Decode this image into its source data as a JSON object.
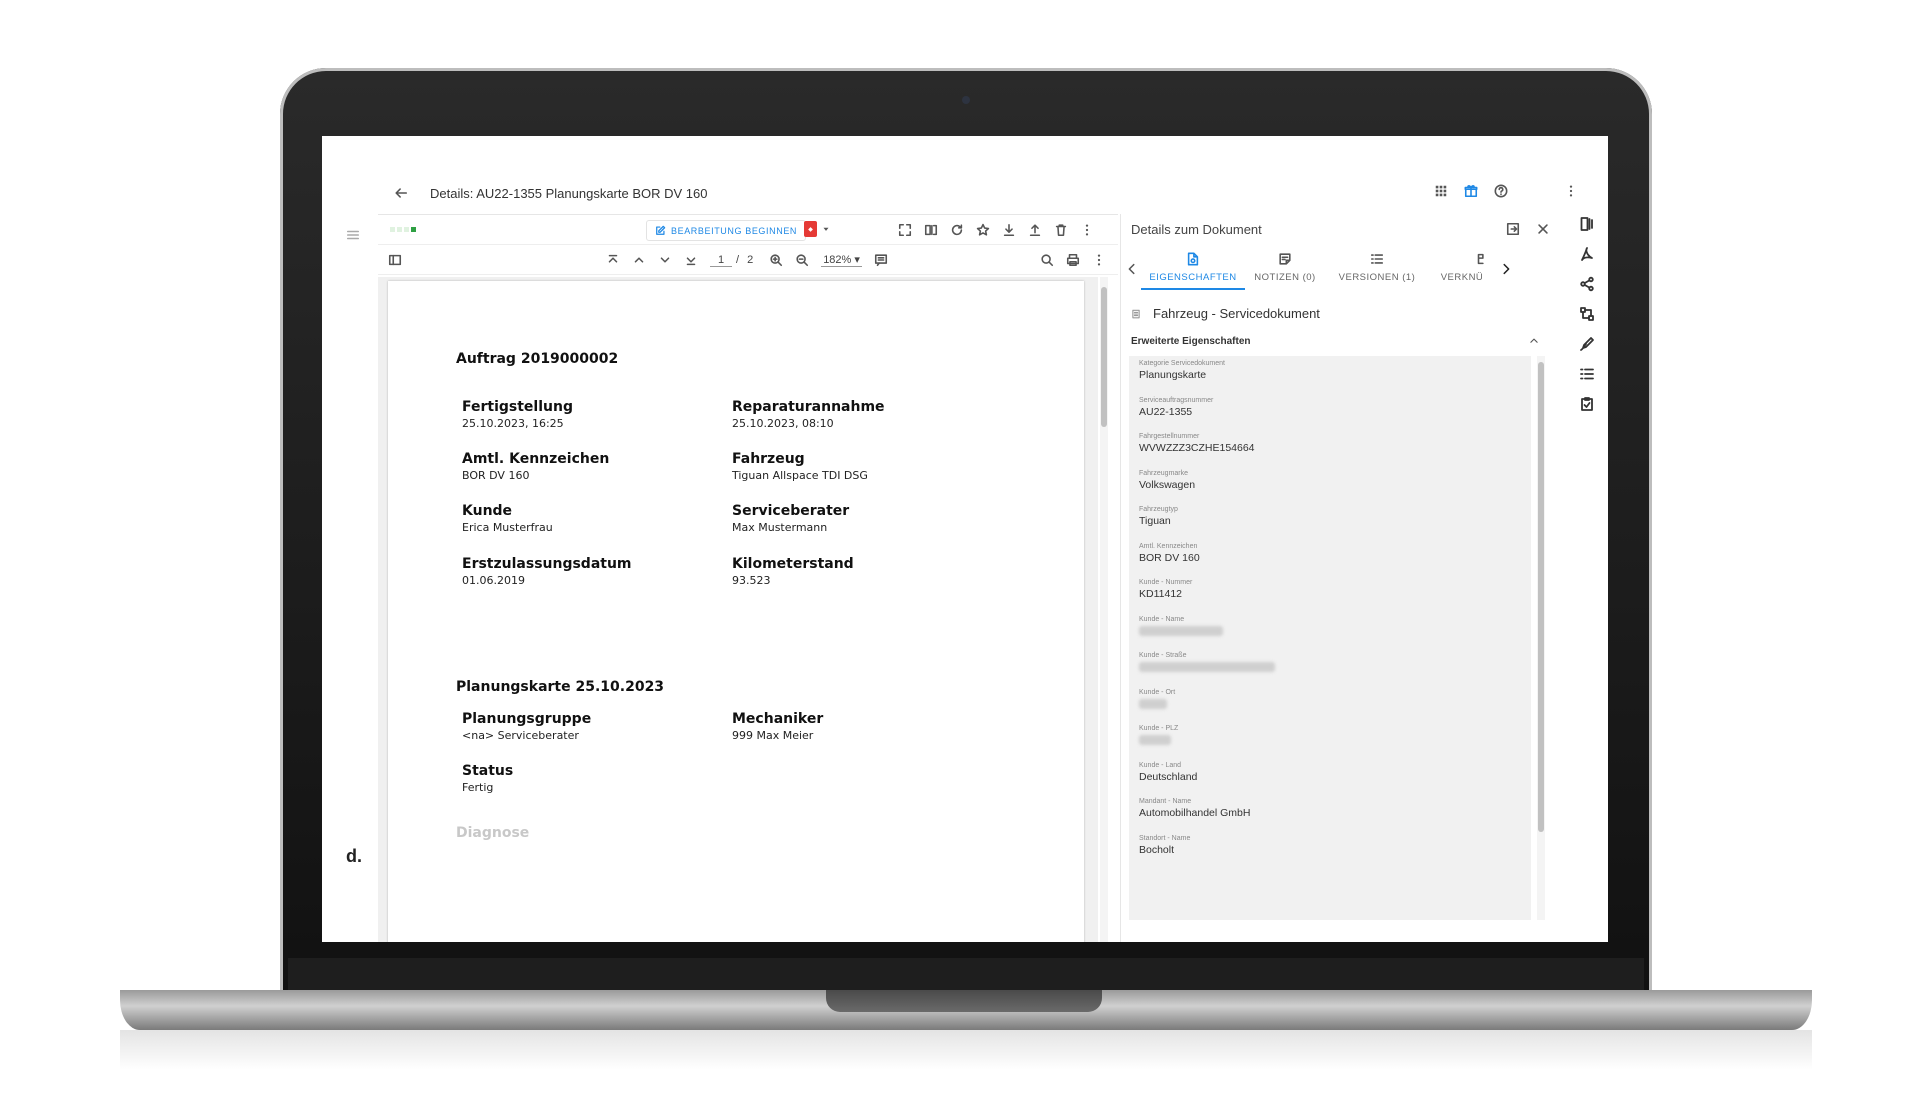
{
  "app": {
    "title": "Details: AU22-1355 Planungskarte BOR DV 160",
    "logo": "d."
  },
  "viewer": {
    "edit_button": "BEARBEITUNG BEGINNEN",
    "current_page": "1",
    "page_separator": "/",
    "total_pages": "2",
    "zoom": "182%"
  },
  "document": {
    "order_title": "Auftrag 2019000002",
    "fields": [
      {
        "label": "Fertigstellung",
        "value": "25.10.2023, 16:25"
      },
      {
        "label": "Reparaturannahme",
        "value": "25.10.2023, 08:10"
      },
      {
        "label": "Amtl. Kennzeichen",
        "value": "BOR DV 160"
      },
      {
        "label": "Fahrzeug",
        "value": "Tiguan Allspace TDI DSG"
      },
      {
        "label": "Kunde",
        "value": "Erica Musterfrau"
      },
      {
        "label": "Serviceberater",
        "value": "Max Mustermann"
      },
      {
        "label": "Erstzulassungsdatum",
        "value": "01.06.2019"
      },
      {
        "label": "Kilometerstand",
        "value": "93.523"
      }
    ],
    "plan_title": "Planungskarte 25.10.2023",
    "plan_fields": [
      {
        "label": "Planungsgruppe",
        "value": "<na> Serviceberater"
      },
      {
        "label": "Mechaniker",
        "value": "999 Max Meier"
      },
      {
        "label": "Status",
        "value": "Fertig"
      }
    ],
    "diagnose": "Diagnose"
  },
  "details": {
    "header": "Details zum Dokument",
    "tabs": [
      "EIGENSCHAFTEN",
      "NOTIZEN (0)",
      "VERSIONEN (1)",
      "VERKNÜ"
    ],
    "doc_type": "Fahrzeug - Servicedokument",
    "section": "Erweiterte Eigenschaften",
    "properties": [
      {
        "label": "Kategorie Servicedokument",
        "value": "Planungskarte"
      },
      {
        "label": "Serviceauftragsnummer",
        "value": "AU22-1355"
      },
      {
        "label": "Fahrgestellnummer",
        "value": "WVWZZZ3CZHE154664"
      },
      {
        "label": "Fahrzeugmarke",
        "value": "Volkswagen"
      },
      {
        "label": "Fahrzeugtyp",
        "value": "Tiguan"
      },
      {
        "label": "Amtl. Kennzeichen",
        "value": "BOR DV 160"
      },
      {
        "label": "Kunde - Nummer",
        "value": "KD11412"
      },
      {
        "label": "Kunde - Name",
        "value": ""
      },
      {
        "label": "Kunde - Straße",
        "value": ""
      },
      {
        "label": "Kunde - Ort",
        "value": ""
      },
      {
        "label": "Kunde - PLZ",
        "value": ""
      },
      {
        "label": "Kunde - Land",
        "value": "Deutschland"
      },
      {
        "label": "Mandant - Name",
        "value": "Automobilhandel GmbH"
      },
      {
        "label": "Standort - Name",
        "value": "Bocholt"
      }
    ]
  },
  "colors": {
    "accent": "#1e88e5",
    "pdf": "#e53935",
    "loading": "#2ea043"
  }
}
